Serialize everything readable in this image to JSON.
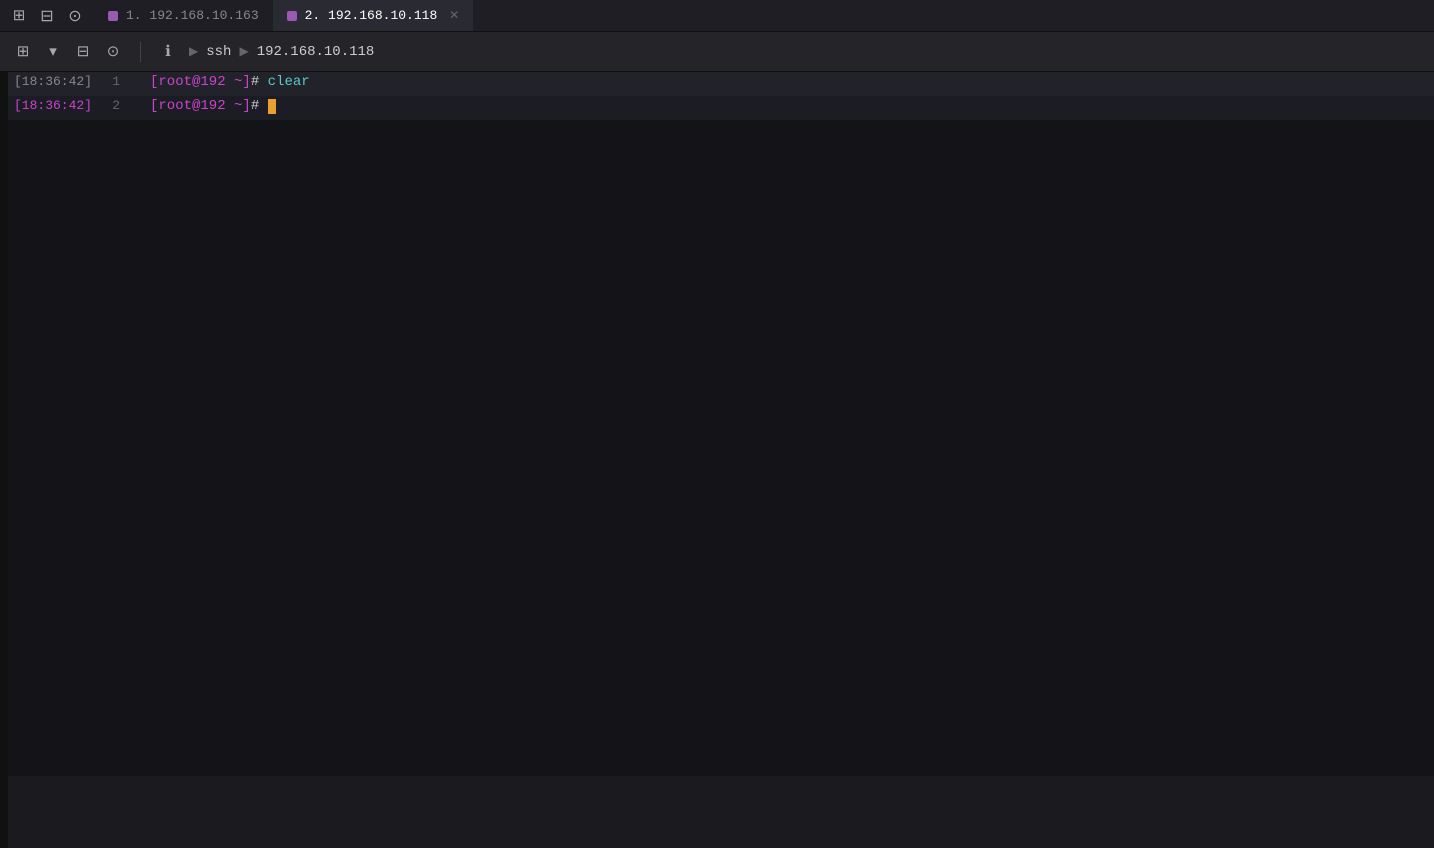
{
  "tabs": [
    {
      "id": "tab1",
      "label": "1. 192.168.10.163",
      "active": false,
      "indicator_color": "#9b59b6",
      "closeable": false
    },
    {
      "id": "tab2",
      "label": "2. 192.168.10.118",
      "active": true,
      "indicator_color": "#9b59b6",
      "closeable": true
    }
  ],
  "toolbar": {
    "info_icon": "ℹ",
    "play_icon": "▶",
    "ssh_label": "ssh",
    "arrow1": "▶",
    "host_label": "192.168.10.118",
    "new_tab_icon": "⊞",
    "split_icon": "⊟",
    "settings_icon": "⊙"
  },
  "terminal": {
    "lines": [
      {
        "time": "[18:36:42]",
        "num": "1",
        "prompt": "[root@192 ~]#",
        "command": "clear",
        "command_color": "#5bc8c8",
        "bg": "#22222a",
        "time_color": "#888888"
      },
      {
        "time": "[18:36:42]",
        "num": "2",
        "prompt": "[root@192 ~]#",
        "command": "",
        "cursor": true,
        "bg": "#1a1a22",
        "time_color": "#cc44cc"
      }
    ]
  }
}
